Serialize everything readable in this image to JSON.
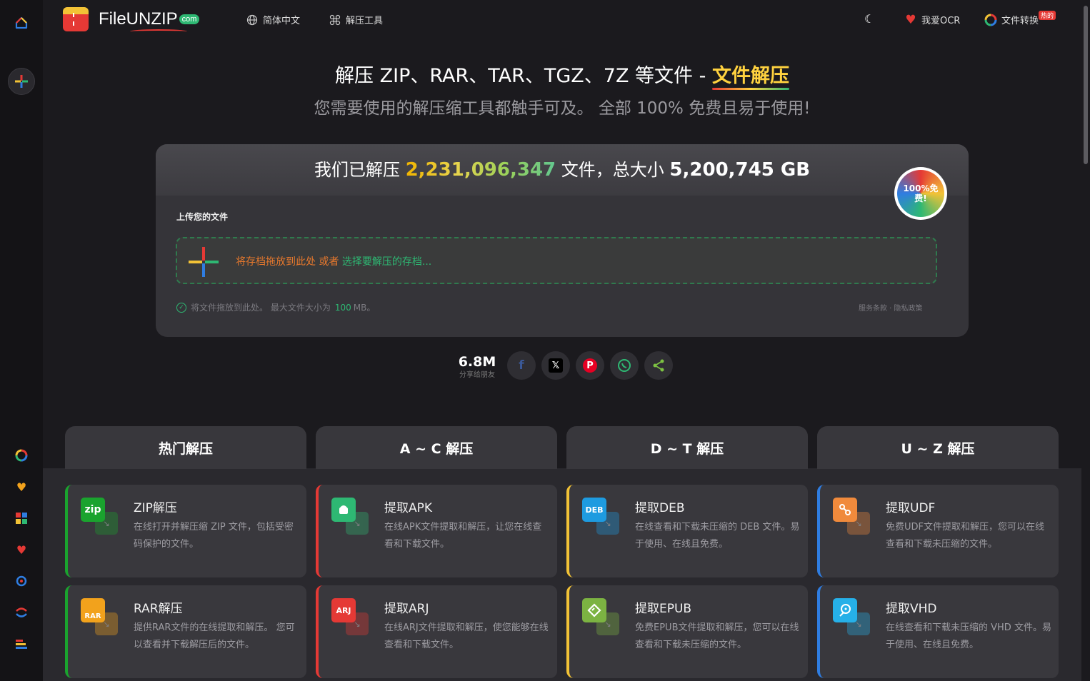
{
  "header": {
    "logo_text": "FileUNZIP",
    "logo_suffix": "com",
    "language": "简体中文",
    "tools": "解压工具",
    "ocr": "我爱OCR",
    "convert": "文件转换",
    "convert_badge": "热的"
  },
  "hero": {
    "title_prefix": "解压 ZIP、RAR、TAR、TGZ、7Z 等文件 - ",
    "title_accent": "文件解压",
    "subtitle": "您需要使用的解压缩工具都触手可及。 全部 100% 免费且易于使用!"
  },
  "upload": {
    "stat_prefix": "我们已解压",
    "files_count": "2,231,096,347",
    "stat_mid": "文件，总大小",
    "total_size": "5,200,745 GB",
    "badge": "100%免费!",
    "label": "上传您的文件",
    "drop_text": "将存档拖放到此处 或者",
    "pick_text": "选择要解压的存档...",
    "hint_prefix": "将文件拖放到此处。 最大文件大小为",
    "hint_size": "100",
    "hint_suffix": "MB。",
    "links": "服务条款 · 隐私政策"
  },
  "share": {
    "count": "6.8M",
    "label": "分享给朋友",
    "buttons": [
      "facebook",
      "x",
      "pinterest",
      "whatsapp",
      "share"
    ]
  },
  "tabs": [
    "热门解压",
    "A ~ C 解压",
    "D ~ T 解压",
    "U ~ Z 解压"
  ],
  "items": [
    {
      "title": "ZIP解压",
      "desc": "在线打开并解压缩 ZIP 文件，包括受密码保护的文件。",
      "icon": "zip",
      "color": "#1aa32e"
    },
    {
      "title": "提取APK",
      "desc": "在线APK文件提取和解压，让您在线查看和下载文件。",
      "icon": "android-icon",
      "color": "#2eb873"
    },
    {
      "title": "提取DEB",
      "desc": "在线查看和下载未压缩的 DEB 文件。易于使用、在线且免费。",
      "icon": "DEB",
      "color": "#1e9be0"
    },
    {
      "title": "提取UDF",
      "desc": "免费UDF文件提取和解压，您可以在线查看和下载未压缩的文件。",
      "icon": "disc-icon",
      "color": "#f08a3c"
    },
    {
      "title": "RAR解压",
      "desc": "提供RAR文件的在线提取和解压。 您可以查看并下载解压后的文件。",
      "icon": "RAR",
      "color": "#f2a21c"
    },
    {
      "title": "提取ARJ",
      "desc": "在线ARJ文件提取和解压，使您能够在线查看和下载文件。",
      "icon": "ARJ",
      "color": "#e53935"
    },
    {
      "title": "提取EPUB",
      "desc": "免费EPUB文件提取和解压，您可以在线查看和下载未压缩的文件。",
      "icon": "epub-icon",
      "color": "#7cb342"
    },
    {
      "title": "提取VHD",
      "desc": "在线查看和下载未压缩的 VHD 文件。易于使用、在线且免费。",
      "icon": "disk-icon",
      "color": "#26b0e8"
    }
  ]
}
